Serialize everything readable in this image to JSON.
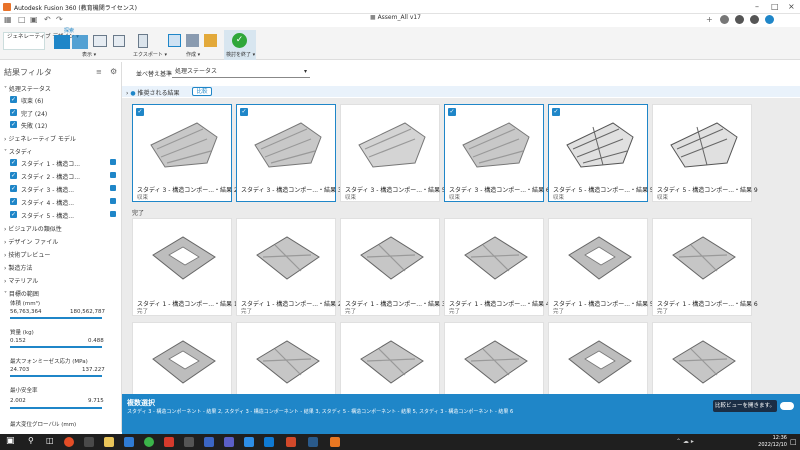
{
  "window": {
    "title": "Autodesk Fusion 360 (教育機関ライセンス)",
    "document_tab": "Assem_All v17"
  },
  "ribbon": {
    "workspace": "ジェネレーティブ デザイン",
    "tab_explore": "探索",
    "display_label": "表示",
    "export_label": "エクスポート",
    "create_label": "作成",
    "finish_label": "検討を終了"
  },
  "filters": {
    "title": "結果フィルタ",
    "status": {
      "label": "処理ステータス",
      "items": [
        "収束 (6)",
        "完了 (24)",
        "失敗 (12)"
      ]
    },
    "gen_model": "ジェネレーティブ モデル",
    "studies": {
      "label": "スタディ",
      "items": [
        "スタディ 1 - 構造コ...",
        "スタディ 2 - 構造コ...",
        "スタディ 3 - 構造...",
        "スタディ 4 - 構造...",
        "スタディ 5 - 構造..."
      ]
    },
    "others": [
      "ビジュアルの類似性",
      "デザイン ファイル",
      "技術プレビュー",
      "製造方法",
      "マテリアル"
    ],
    "objectives": {
      "label": "目標の範囲",
      "volume": {
        "label": "体積 (mm³)",
        "min": "56,763,364",
        "max": "180,562,787"
      },
      "mass": {
        "label": "質量 (kg)",
        "min": "0.152",
        "max": "0.488"
      },
      "stress": {
        "label": "最大フォンミーゼス応力 (MPa)",
        "min": "24.703",
        "max": "137.227"
      },
      "safety": {
        "label": "最小安全率",
        "min": "2.002",
        "max": "9.715"
      },
      "displacement": {
        "label": "最大変位グローバル (mm)"
      }
    }
  },
  "sort": {
    "label": "並べ替え基準",
    "value": "処理ステータス"
  },
  "compare": {
    "label": "推奨される結果",
    "button": "比較"
  },
  "section_done": "完了",
  "row1": [
    {
      "label": "スタディ 3 - 構造コンポー...・結果 2",
      "sub": "収束",
      "selected": true
    },
    {
      "label": "スタディ 3 - 構造コンポー...・結果 3",
      "sub": "",
      "selected": true
    },
    {
      "label": "スタディ 3 - 構造コンポー...・結果 5",
      "sub": "収束",
      "selected": false
    },
    {
      "label": "スタディ 3 - 構造コンポー...・結果 6",
      "sub": "収束",
      "selected": true
    },
    {
      "label": "スタディ 5 - 構造コンポー...・結果 5",
      "sub": "収束",
      "selected": true
    },
    {
      "label": "スタディ 5 - 構造コンポー...・結果 9",
      "sub": "収束",
      "selected": false
    }
  ],
  "row2": [
    {
      "label": "スタディ 1 - 構造コンポー...・結果 1",
      "sub": "完了"
    },
    {
      "label": "スタディ 1 - 構造コンポー...・結果 2",
      "sub": "完了"
    },
    {
      "label": "スタディ 1 - 構造コンポー...・結果 3",
      "sub": "完了"
    },
    {
      "label": "スタディ 1 - 構造コンポー...・結果 4",
      "sub": "完了"
    },
    {
      "label": "スタディ 1 - 構造コンポー...・結果 5",
      "sub": "完了"
    },
    {
      "label": "スタディ 1 - 構造コンポー...・結果 6",
      "sub": "完了"
    }
  ],
  "banner": {
    "title": "複数選択",
    "detail": "スタディ 3 - 構造コンポーネント - 結果 2, スタディ 3 - 構造コンポーネント - 結果 3, スタディ 5 - 構造コンポーネント - 結果 5, スタディ 3 - 構造コンポーネント - 結果 6",
    "tip": "比較ビューを開きます。"
  },
  "clock": {
    "time": "12:36",
    "date": "2022/12/10"
  },
  "colors": {
    "accent": "#1f86c8",
    "banner": "#1f86c8",
    "taskbar": "#1f1f1f"
  }
}
